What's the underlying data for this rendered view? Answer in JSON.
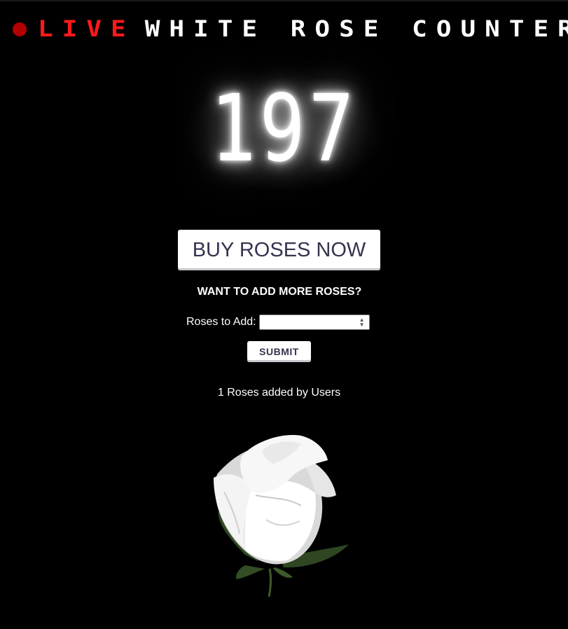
{
  "header": {
    "live_label": "LIVE",
    "title": "WHITE ROSE COUNTER",
    "live_color": "#ff1a1a",
    "dot_color": "#b30000"
  },
  "counter": {
    "value": "197"
  },
  "buy_button": {
    "label": "BUY ROSES NOW"
  },
  "add_section": {
    "heading": "WANT TO ADD MORE ROSES?",
    "input_label": "Roses to Add:",
    "input_value": "",
    "input_placeholder": "",
    "submit_label": "SUBMIT"
  },
  "stats": {
    "added_text": "1 Roses added by Users"
  },
  "image": {
    "icon": "white-rose-image"
  }
}
